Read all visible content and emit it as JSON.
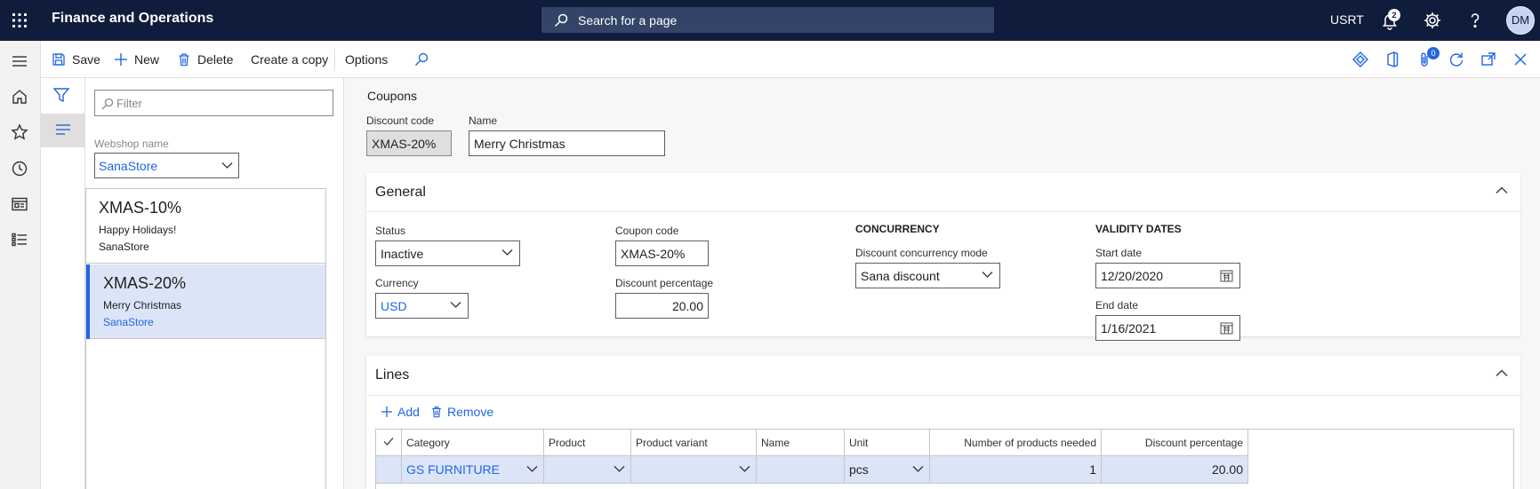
{
  "topbar": {
    "app_title": "Finance and Operations",
    "search_placeholder": "Search for a page",
    "company": "USRT",
    "notification_count": "2",
    "user_initials": "DM"
  },
  "actions": {
    "save": "Save",
    "new": "New",
    "delete": "Delete",
    "create_copy": "Create a copy",
    "options": "Options",
    "attachments_count": "0"
  },
  "list_pane": {
    "filter_placeholder": "Filter",
    "webshop_label": "Webshop name",
    "webshop_value": "SanaStore",
    "items": [
      {
        "code": "XMAS-10%",
        "name": "Happy Holidays!",
        "webshop": "SanaStore",
        "selected": false
      },
      {
        "code": "XMAS-20%",
        "name": "Merry Christmas",
        "webshop": "SanaStore",
        "selected": true
      }
    ]
  },
  "header": {
    "caption": "Coupons",
    "discount_code_label": "Discount code",
    "discount_code_value": "XMAS-20%",
    "name_label": "Name",
    "name_value": "Merry Christmas"
  },
  "general": {
    "title": "General",
    "status_label": "Status",
    "status_value": "Inactive",
    "currency_label": "Currency",
    "currency_value": "USD",
    "coupon_code_label": "Coupon code",
    "coupon_code_value": "XMAS-20%",
    "discount_pct_label": "Discount percentage",
    "discount_pct_value": "20.00",
    "concurrency_title": "CONCURRENCY",
    "concurrency_mode_label": "Discount concurrency mode",
    "concurrency_mode_value": "Sana discount",
    "validity_title": "VALIDITY DATES",
    "start_date_label": "Start date",
    "start_date_value": "12/20/2020",
    "end_date_label": "End date",
    "end_date_value": "1/16/2021"
  },
  "lines": {
    "title": "Lines",
    "add": "Add",
    "remove": "Remove",
    "columns": [
      "Category",
      "Product",
      "Product variant",
      "Name",
      "Unit",
      "Number of products needed",
      "Discount percentage"
    ],
    "rows": [
      {
        "category": "GS FURNITURE",
        "product": "",
        "product_variant": "",
        "name": "",
        "unit": "pcs",
        "products_needed": "1",
        "discount_pct": "20.00"
      }
    ]
  },
  "colors": {
    "nav_bg": "#0f1c3b",
    "accent": "#2266e3",
    "selected_row": "#dbe5f7"
  }
}
